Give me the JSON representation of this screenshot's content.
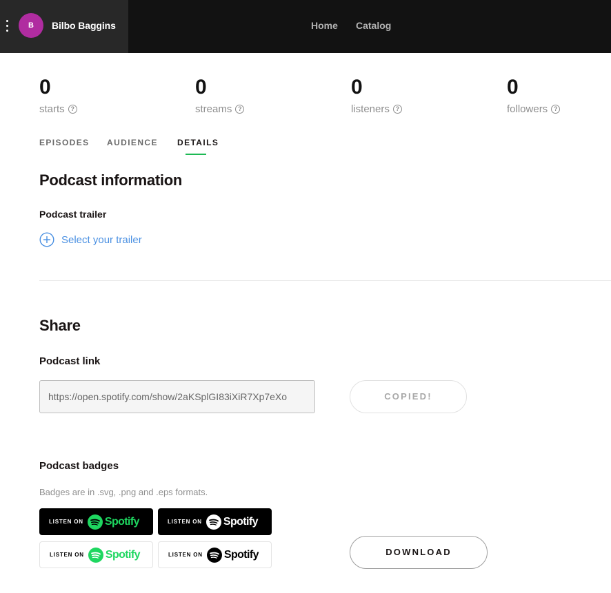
{
  "topbar": {
    "user": {
      "initial": "B",
      "name": "Bilbo Baggins"
    },
    "nav": [
      "Home",
      "Catalog"
    ]
  },
  "stats": [
    {
      "value": "0",
      "label": "starts"
    },
    {
      "value": "0",
      "label": "streams"
    },
    {
      "value": "0",
      "label": "listeners"
    },
    {
      "value": "0",
      "label": "followers"
    }
  ],
  "tabs": [
    {
      "label": "EPISODES",
      "active": false
    },
    {
      "label": "AUDIENCE",
      "active": false
    },
    {
      "label": "DETAILS",
      "active": true
    }
  ],
  "podcast_info": {
    "heading": "Podcast information",
    "trailer_label": "Podcast trailer",
    "select_trailer": "Select your trailer"
  },
  "share": {
    "heading": "Share",
    "link_label": "Podcast link",
    "link_value": "https://open.spotify.com/show/2aKSplGI83iXiR7Xp7eXo",
    "copy_button": "COPIED!",
    "badges_label": "Podcast badges",
    "badges_note": "Badges are in .svg, .png and .eps formats.",
    "badges": [
      {
        "listen": "LISTEN ON",
        "brand": "Spotify",
        "background": "#000000",
        "logo_color": "#1ED760",
        "word_color": "#1ED760"
      },
      {
        "listen": "LISTEN ON",
        "brand": "Spotify",
        "background": "#000000",
        "logo_color": "#FFFFFF",
        "word_color": "#FFFFFF"
      },
      {
        "listen": "LISTEN ON",
        "brand": "Spotify",
        "background": "#FFFFFF",
        "logo_color": "#1ED760",
        "word_color": "#1ED760"
      },
      {
        "listen": "LISTEN ON",
        "brand": "Spotify",
        "background": "#FFFFFF",
        "logo_color": "#000000",
        "word_color": "#000000"
      }
    ],
    "download_button": "DOWNLOAD"
  },
  "colors": {
    "accent": "#1DB954",
    "link": "#4A90E2",
    "avatar": "#B02CA0",
    "topbar": "#121212"
  },
  "icons": [
    "more-vertical-icon",
    "help-icon",
    "plus-circle-icon",
    "spotify-logo-icon"
  ]
}
